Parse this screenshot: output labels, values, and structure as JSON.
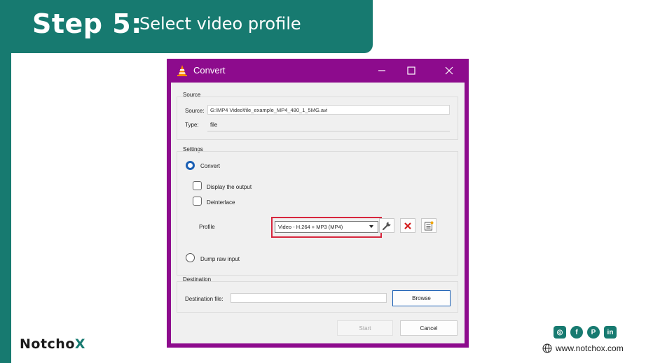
{
  "banner": {
    "step": "Step 5:",
    "text": "Select video profile"
  },
  "brand": {
    "prefix": "Notch",
    "o": "o",
    "x": "X"
  },
  "site": {
    "url": "www.notchox.com"
  },
  "socials": [
    {
      "name": "instagram-icon",
      "glyph": "◎"
    },
    {
      "name": "facebook-icon",
      "glyph": "f"
    },
    {
      "name": "pinterest-icon",
      "glyph": "P"
    },
    {
      "name": "linkedin-icon",
      "glyph": "in"
    }
  ],
  "dialog": {
    "title": "Convert",
    "source": {
      "group_label": "Source",
      "source_label": "Source:",
      "source_value": "G:\\MP4 Video\\file_example_MP4_480_1_5MG.avi",
      "type_label": "Type:",
      "type_value": "file"
    },
    "settings": {
      "group_label": "Settings",
      "convert_label": "Convert",
      "display_output_label": "Display the output",
      "deinterlace_label": "Deinterlace",
      "profile_label": "Profile",
      "profile_value": "Video - H.264 + MP3 (MP4)",
      "dump_raw_label": "Dump raw input"
    },
    "destination": {
      "group_label": "Destination",
      "file_label": "Destination file:",
      "file_value": "",
      "browse_label": "Browse"
    },
    "start_label": "Start",
    "cancel_label": "Cancel"
  },
  "colors": {
    "teal": "#177a70",
    "magenta": "#8d0b8d",
    "highlight": "#d7263d",
    "accent": "#1a5fb4"
  }
}
